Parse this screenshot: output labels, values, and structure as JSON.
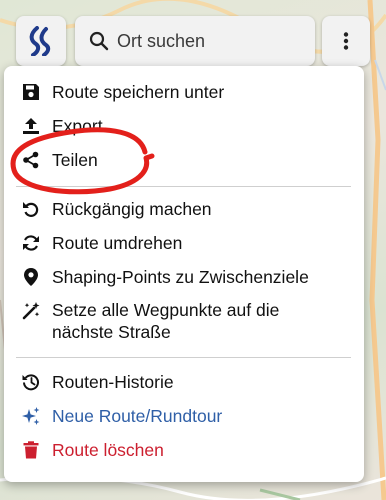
{
  "search": {
    "placeholder": "Ort suchen"
  },
  "menu": {
    "items": [
      {
        "label": "Route speichern unter",
        "icon": "save-icon"
      },
      {
        "label": "Export",
        "icon": "upload-icon"
      },
      {
        "label": "Teilen",
        "icon": "share-icon"
      },
      {
        "label": "Rückgängig machen",
        "icon": "undo-icon"
      },
      {
        "label": "Route umdrehen",
        "icon": "reverse-icon"
      },
      {
        "label": "Shaping-Points zu Zwischenziele",
        "icon": "location-pin-icon"
      },
      {
        "label": "Setze alle Wegpunkte auf die nächste Straße",
        "icon": "magic-wand-icon"
      },
      {
        "label": "Routen-Historie",
        "icon": "history-icon"
      },
      {
        "label": "Neue Route/Rundtour",
        "icon": "sparkles-icon"
      },
      {
        "label": "Route löschen",
        "icon": "trash-icon"
      }
    ]
  },
  "colors": {
    "brand": "#1f3a8a",
    "link_blue": "#2f5fa7",
    "danger_red": "#cc1f2f",
    "annotation_red": "#e3201b"
  }
}
